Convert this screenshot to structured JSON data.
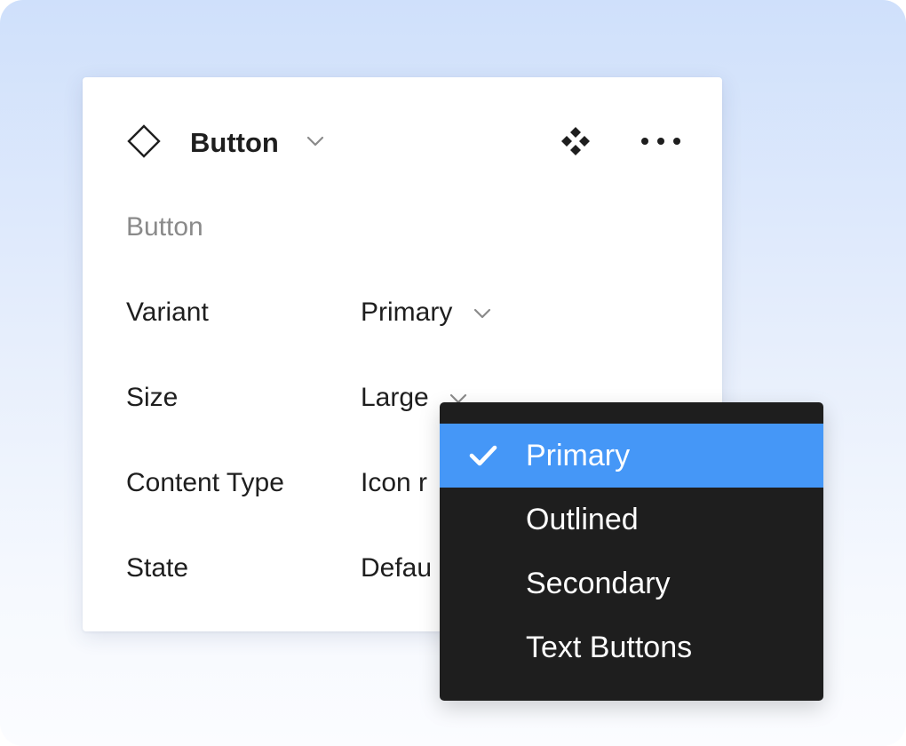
{
  "header": {
    "title": "Button",
    "component_icon": "diamond-outline-icon",
    "title_chevron_icon": "chevron-down-icon",
    "instance_icon": "component-instance-icon",
    "more_icon": "more-horizontal-icon"
  },
  "section": {
    "label": "Button"
  },
  "properties": [
    {
      "name": "Variant",
      "value": "Primary"
    },
    {
      "name": "Size",
      "value": "Large"
    },
    {
      "name": "Content Type",
      "value": "Icon r"
    },
    {
      "name": "State",
      "value": "Defau"
    }
  ],
  "dropdown": {
    "check_icon": "checkmark-icon",
    "options": [
      {
        "label": "Primary",
        "selected": true
      },
      {
        "label": "Outlined",
        "selected": false
      },
      {
        "label": "Secondary",
        "selected": false
      },
      {
        "label": "Text Buttons",
        "selected": false
      }
    ]
  },
  "colors": {
    "selected_option": "#4597f7",
    "dropdown_background": "#1e1e1e",
    "panel_background": "#ffffff",
    "secondary_text": "#8a8a8a"
  }
}
